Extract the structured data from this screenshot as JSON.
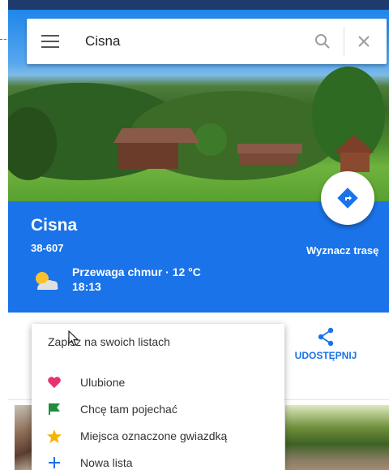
{
  "search": {
    "query": "Cisna"
  },
  "place": {
    "title": "Cisna",
    "postal_code": "38-607",
    "weather_desc": "Przewaga chmur · 12 °C",
    "weather_time": "18:13",
    "route_label": "Wyznacz trasę"
  },
  "actions": {
    "share_label": "UDOSTĘPNIJ"
  },
  "save_menu": {
    "title": "Zapisz na swoich listach",
    "items": [
      {
        "label": "Ulubione",
        "icon": "heart-icon",
        "color": "#e8336d"
      },
      {
        "label": "Chcę tam pojechać",
        "icon": "flag-icon",
        "color": "#1e8e3e"
      },
      {
        "label": "Miejsca oznaczone gwiazdką",
        "icon": "star-icon",
        "color": "#f6b400"
      },
      {
        "label": "Nowa lista",
        "icon": "plus-icon",
        "color": "#1a73e8"
      }
    ]
  },
  "colors": {
    "accent": "#1a73e8"
  }
}
